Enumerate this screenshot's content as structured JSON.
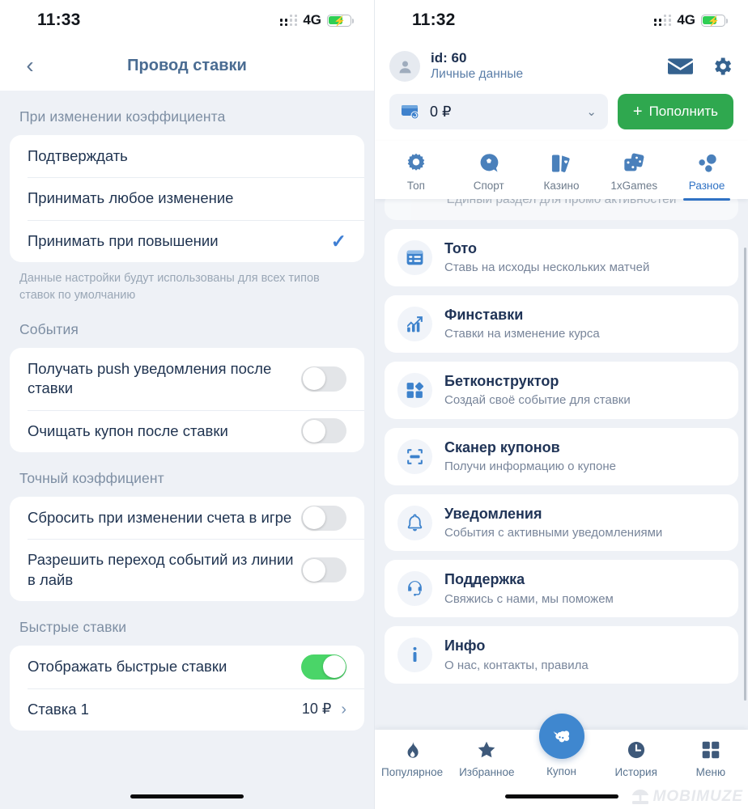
{
  "left": {
    "status": {
      "time": "11:33",
      "network": "4G",
      "battery_state": "charging"
    },
    "navbar": {
      "title": "Провод ставки",
      "back_icon": "chevron-left-icon"
    },
    "sections": [
      {
        "header": "При изменении коэффициента",
        "rows": [
          {
            "label": "Подтверждать",
            "control": "none"
          },
          {
            "label": "Принимать любое изменение",
            "control": "none"
          },
          {
            "label": "Принимать при повышении",
            "control": "check"
          }
        ],
        "hint": "Данные настройки будут использованы для всех типов ставок по умолчанию"
      },
      {
        "header": "События",
        "rows": [
          {
            "label": "Получать push уведомления после ставки",
            "control": "toggle",
            "value": "off"
          },
          {
            "label": "Очищать купон после ставки",
            "control": "toggle",
            "value": "off"
          }
        ]
      },
      {
        "header": "Точный коэффициент",
        "rows": [
          {
            "label": "Сбросить при изменении счета в игре",
            "control": "toggle",
            "value": "off"
          },
          {
            "label": "Разрешить переход событий из линии в лайв",
            "control": "toggle",
            "value": "off"
          }
        ]
      },
      {
        "header": "Быстрые ставки",
        "rows": [
          {
            "label": "Отображать быстрые ставки",
            "control": "toggle",
            "value": "on"
          },
          {
            "label": "Ставка 1",
            "control": "value",
            "value": "10 ₽",
            "chevron": "chevron-right-icon"
          }
        ]
      }
    ]
  },
  "right": {
    "status": {
      "time": "11:32",
      "network": "4G",
      "battery_state": "charging"
    },
    "account": {
      "avatar_icon": "user-avatar-icon",
      "id": "id: 60",
      "personal_data_link": "Личные данные",
      "mail_icon": "mail-icon",
      "settings_icon": "gear-icon"
    },
    "balance": {
      "wallet_icon": "wallet-icon",
      "amount": "0 ₽",
      "dropdown_icon": "chevron-down-icon",
      "topup_label": "Пополнить",
      "topup_plus": "+",
      "topup_color": "#2fa84f"
    },
    "tabs": [
      {
        "label": "Топ",
        "icon": "gear-star-icon",
        "active": false
      },
      {
        "label": "Спорт",
        "icon": "soccer-ball-icon",
        "active": false
      },
      {
        "label": "Казино",
        "icon": "playing-cards-icon",
        "active": false
      },
      {
        "label": "1xGames",
        "icon": "dice-icon",
        "active": false
      },
      {
        "label": "Разное",
        "icon": "dots-cluster-icon",
        "active": true
      }
    ],
    "peek_item_subtitle": "Единый раздел для промо активностей",
    "menu_items": [
      {
        "title": "Тото",
        "subtitle": "Ставь на исходы нескольких матчей",
        "icon": "list-card-icon"
      },
      {
        "title": "Финставки",
        "subtitle": "Ставки на изменение курса",
        "icon": "chart-growth-icon"
      },
      {
        "title": "Бетконструктор",
        "subtitle": "Создай своё событие для ставки",
        "icon": "blocks-icon"
      },
      {
        "title": "Сканер купонов",
        "subtitle": "Получи информацию о купоне",
        "icon": "scanner-icon"
      },
      {
        "title": "Уведомления",
        "subtitle": "События с активными уведомлениями",
        "icon": "bell-icon"
      },
      {
        "title": "Поддержка",
        "subtitle": "Свяжись с нами, мы поможем",
        "icon": "headset-icon"
      },
      {
        "title": "Инфо",
        "subtitle": "О нас, контакты, правила",
        "icon": "info-icon"
      }
    ],
    "bottom_nav": [
      {
        "label": "Популярное",
        "icon": "flame-icon",
        "active": false
      },
      {
        "label": "Избранное",
        "icon": "star-icon",
        "active": false
      },
      {
        "label": "Купон",
        "icon": "ticket-icon",
        "active": true
      },
      {
        "label": "История",
        "icon": "clock-icon",
        "active": false
      },
      {
        "label": "Меню",
        "icon": "grid-icon",
        "active": false
      }
    ],
    "watermark": {
      "text": "MOBIMUZE",
      "icon": "watermark-logo-icon"
    }
  }
}
